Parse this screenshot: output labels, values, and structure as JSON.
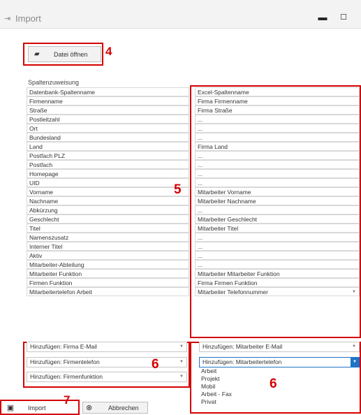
{
  "window": {
    "title": "Import",
    "icon": "import-icon",
    "minimize": "▬",
    "maximize": "☐"
  },
  "open_button": {
    "label": "Datei öffnen",
    "icon": "folder-open-icon",
    "annotation": "4"
  },
  "mapping": {
    "group_label": "Spaltenzuweisung",
    "annotation": "5",
    "rows": [
      {
        "left": "Datenbank-Spaltenname",
        "right": "Excel-Spaltenname"
      },
      {
        "left": "Firmenname",
        "right": "Firma Firmenname"
      },
      {
        "left": "Straße",
        "right": "Firma Straße"
      },
      {
        "left": "Postleitzahl",
        "right": "..."
      },
      {
        "left": "Ort",
        "right": "..."
      },
      {
        "left": "Bundesland",
        "right": "..."
      },
      {
        "left": "Land",
        "right": "Firma Land"
      },
      {
        "left": "Postfach PLZ",
        "right": "..."
      },
      {
        "left": "Postfach",
        "right": "..."
      },
      {
        "left": "Homepage",
        "right": "..."
      },
      {
        "left": "UID",
        "right": "..."
      },
      {
        "left": "Vorname",
        "right": "Mitarbeiter Vorname"
      },
      {
        "left": "Nachname",
        "right": "Mitarbeiter Nachname"
      },
      {
        "left": "Abkürzung",
        "right": "..."
      },
      {
        "left": "Geschlecht",
        "right": "Mitarbeiter Geschlecht"
      },
      {
        "left": "Titel",
        "right": "Mitarbeiter Titel"
      },
      {
        "left": "Namenszusatz",
        "right": "..."
      },
      {
        "left": "Interner Titel",
        "right": "..."
      },
      {
        "left": "Aktiv",
        "right": "..."
      },
      {
        "left": "Mitarbeiter-Abteilung",
        "right": "..."
      },
      {
        "left": "Mitarbeiter Funktion",
        "right": "Mitarbeiter Mitarbeiter Funktion"
      },
      {
        "left": "Firmen Funktion",
        "right": "Firma Firmen Funktion"
      },
      {
        "left": "Mitarbeitertelefon Arbeit",
        "right": "Mitarbeiter Telefonnummer"
      }
    ]
  },
  "add_left": {
    "annotation": "6",
    "items": [
      "Hinzufügen: Firma E-Mail",
      "Hinzufügen: Firmentelefon",
      "Hinzufügen: Firmenfunktion"
    ]
  },
  "add_right": {
    "annotation": "6",
    "items": [
      "Hinzufügen: Mitarbeiter E-Mail",
      "Hinzufügen: Mitarbeitertelefon"
    ],
    "options": [
      "Arbeit",
      "Projekt",
      "Mobil",
      "Arbeit - Fax",
      "Privat"
    ]
  },
  "bottom": {
    "import_label": "Import",
    "import_icon": "save-icon",
    "import_annotation": "7",
    "cancel_label": "Abbrechen",
    "cancel_icon": "cancel-icon"
  },
  "colors": {
    "annotation_red": "#d40000",
    "dropdown_blue": "#1e74c9"
  }
}
